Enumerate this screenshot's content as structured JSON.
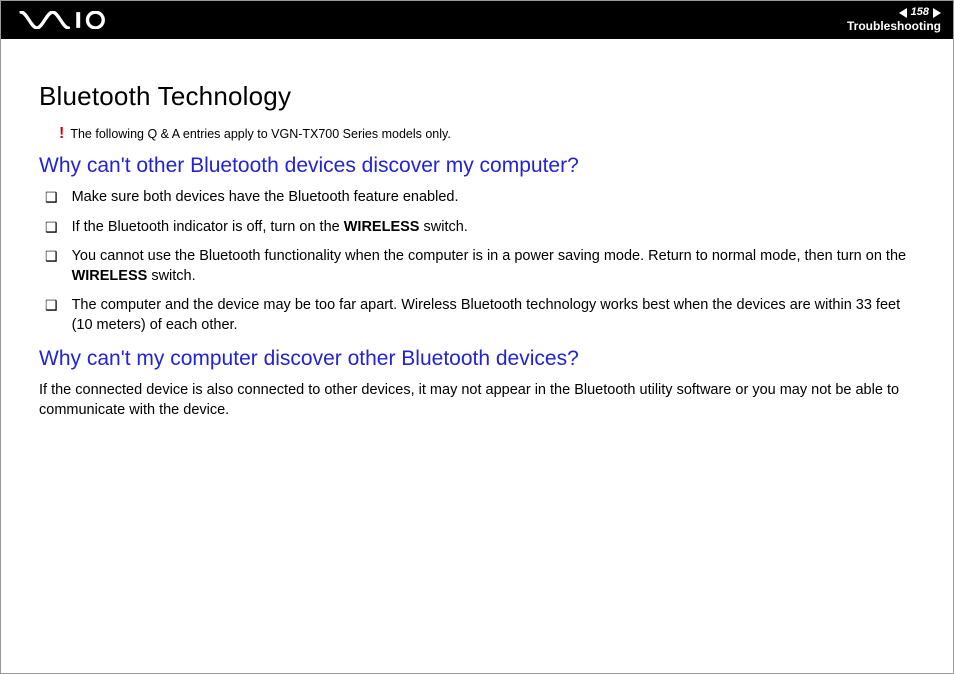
{
  "header": {
    "page_number": "158",
    "section": "Troubleshooting",
    "logo_alt": "VAIO"
  },
  "content": {
    "title": "Bluetooth Technology",
    "note_mark": "!",
    "note_text": "The following Q & A entries apply to VGN-TX700 Series models only.",
    "q1": {
      "question": "Why can't other Bluetooth devices discover my computer?",
      "bullets": [
        {
          "pre": "Make sure both devices have the Bluetooth feature enabled.",
          "bold": "",
          "post": ""
        },
        {
          "pre": "If the Bluetooth indicator is off, turn on the ",
          "bold": "WIRELESS",
          "post": " switch."
        },
        {
          "pre": "You cannot use the Bluetooth functionality when the computer is in a power saving mode. Return to normal mode, then turn on the ",
          "bold": "WIRELESS",
          "post": " switch."
        },
        {
          "pre": "The computer and the device may be too far apart. Wireless Bluetooth technology works best when the devices are within 33 feet (10 meters) of each other.",
          "bold": "",
          "post": ""
        }
      ]
    },
    "q2": {
      "question": "Why can't my computer discover other Bluetooth devices?",
      "paragraph": "If the connected device is also connected to other devices, it may not appear in the Bluetooth utility software or you may not be able to communicate with the device."
    }
  }
}
